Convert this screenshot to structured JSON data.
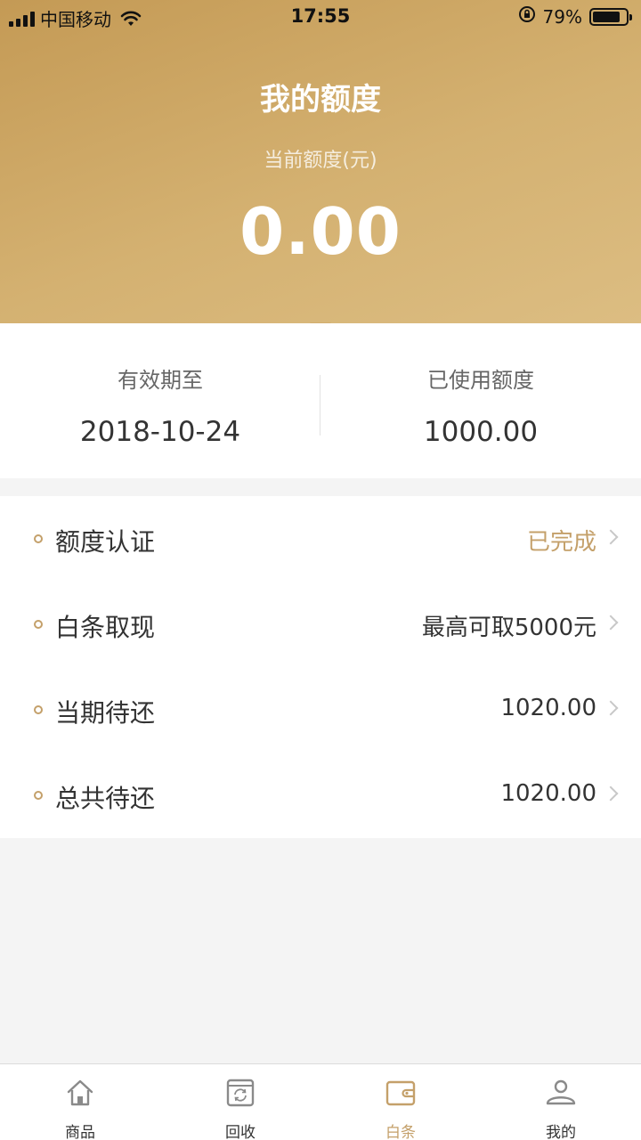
{
  "status_bar": {
    "carrier": "中国移动",
    "time": "17:55",
    "battery_percent": "79%",
    "battery_level": 0.79
  },
  "header": {
    "title": "我的额度",
    "quota_label": "当前额度(元)",
    "quota_value": "0.00"
  },
  "info": {
    "valid_until_label": "有效期至",
    "valid_until_value": "2018-10-24",
    "used_label": "已使用额度",
    "used_value": "1000.00"
  },
  "list": {
    "items": [
      {
        "label": "额度认证",
        "value": "已完成"
      },
      {
        "label": "白条取现",
        "value": "最高可取5000元"
      },
      {
        "label": "当期待还",
        "value": "1020.00"
      },
      {
        "label": "总共待还",
        "value": "1020.00"
      }
    ]
  },
  "tabbar": {
    "tabs": [
      {
        "label": "商品",
        "icon": "home-icon"
      },
      {
        "label": "回收",
        "icon": "recycle-icon"
      },
      {
        "label": "白条",
        "icon": "wallet-icon"
      },
      {
        "label": "我的",
        "icon": "profile-icon"
      }
    ],
    "active_index": 2
  },
  "colors": {
    "accent": "#c4a06a",
    "header_gradient_start": "#c49a55",
    "header_gradient_end": "#dcbd82"
  }
}
